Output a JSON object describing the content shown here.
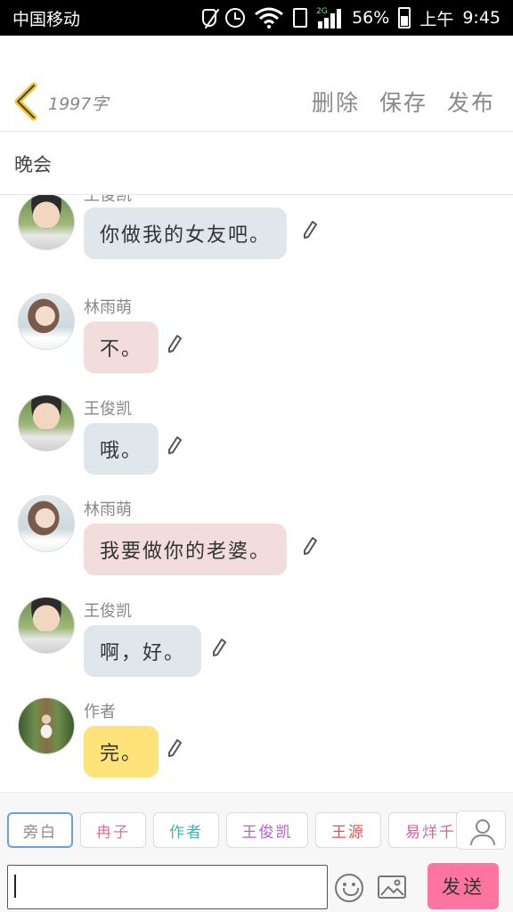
{
  "status_bar": {
    "carrier": "中国移动",
    "network": "2G",
    "battery": "56%",
    "ampm": "上午",
    "time": "9:45",
    "icons": [
      "mute-icon",
      "alarm-icon",
      "wifi-icon",
      "sim-icon",
      "signal-icon",
      "battery-icon"
    ]
  },
  "header": {
    "word_count": "1997字",
    "actions": {
      "delete": "删除",
      "save": "保存",
      "publish": "发布"
    }
  },
  "chapter": {
    "title": "晚会"
  },
  "messages": [
    {
      "name": "王俊凯",
      "text": "你做我的女友吧。",
      "role": "boy"
    },
    {
      "name": "林雨萌",
      "text": "不。",
      "role": "girl"
    },
    {
      "name": "王俊凯",
      "text": "哦。",
      "role": "boy"
    },
    {
      "name": "林雨萌",
      "text": "我要做你的老婆。",
      "role": "girl"
    },
    {
      "name": "王俊凯",
      "text": "啊，好。",
      "role": "boy"
    },
    {
      "name": "作者",
      "text": "完。",
      "role": "author"
    }
  ],
  "roles": [
    {
      "label": "旁白",
      "color": "#8a8a8a",
      "selected": true
    },
    {
      "label": "冉子",
      "color": "#e86a95"
    },
    {
      "label": "作者",
      "color": "#3fb8a8"
    },
    {
      "label": "王俊凯",
      "color": "#b15fd6"
    },
    {
      "label": "王源",
      "color": "#e45050"
    },
    {
      "label": "易烊千",
      "color": "#d45fa0"
    }
  ],
  "input": {
    "value": ""
  },
  "send_button": "发送",
  "colors": {
    "send": "#ff74a0",
    "bubble_boy": "#dfe6ec",
    "bubble_girl": "#f2dcdc",
    "bubble_author": "#fde37a",
    "selected_role_border": "#6e9ed8"
  }
}
